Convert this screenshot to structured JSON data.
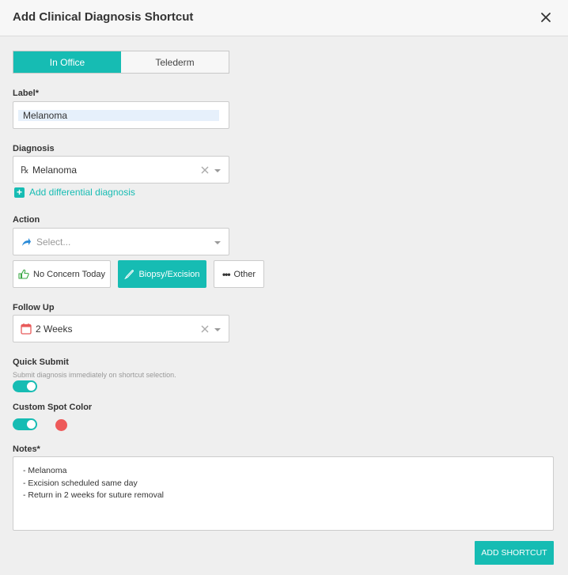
{
  "dialog": {
    "title": "Add Clinical Diagnosis Shortcut"
  },
  "tabs": [
    {
      "label": "In Office",
      "active": true
    },
    {
      "label": "Telederm",
      "active": false
    }
  ],
  "label_field": {
    "label": "Label*",
    "value": "Melanoma"
  },
  "diagnosis": {
    "label": "Diagnosis",
    "value": "Melanoma",
    "add_differential": "Add differential diagnosis"
  },
  "action": {
    "label": "Action",
    "placeholder": "Select...",
    "options": [
      {
        "label": "No Concern Today",
        "icon": "thumbs-up-icon",
        "active": false
      },
      {
        "label": "Biopsy/Excision",
        "icon": "scalpel-icon",
        "active": true
      },
      {
        "label": "Other",
        "icon": "more-dots-icon",
        "active": false
      }
    ]
  },
  "follow_up": {
    "label": "Follow Up",
    "value": "2 Weeks"
  },
  "quick_submit": {
    "label": "Quick Submit",
    "description": "Submit diagnosis immediately on shortcut selection.",
    "enabled": true
  },
  "custom_spot_color": {
    "label": "Custom Spot Color",
    "enabled": true,
    "color": "#ee5a5a"
  },
  "notes": {
    "label": "Notes*",
    "lines": [
      "- Melanoma",
      "- Excision scheduled same day",
      "- Return in 2 weeks for suture removal"
    ]
  },
  "submit_label": "ADD SHORTCUT",
  "colors": {
    "accent": "#16bcb3",
    "spot": "#ee5a5a"
  }
}
